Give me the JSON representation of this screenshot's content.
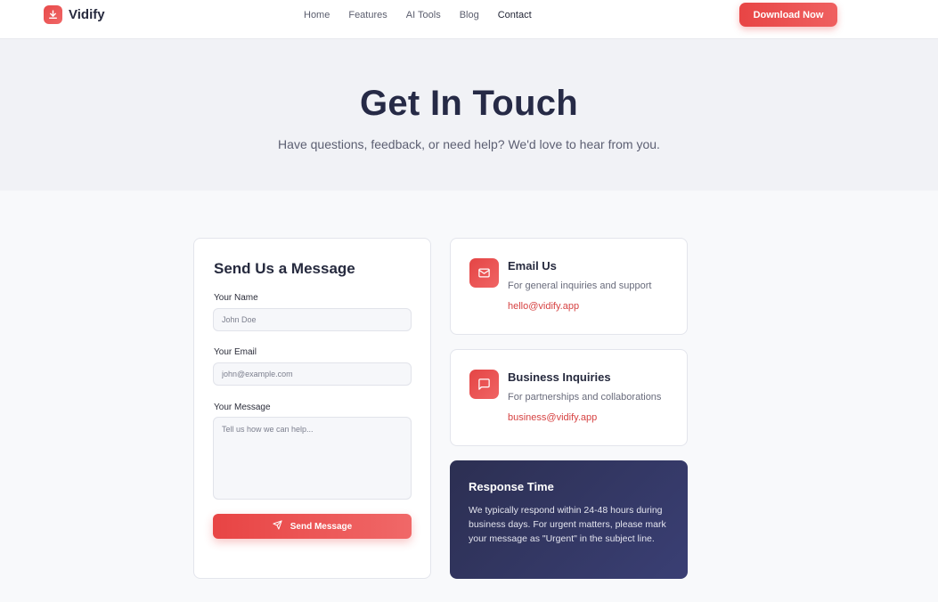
{
  "brand": {
    "name": "Vidify",
    "icon": "download-icon",
    "accent": "#e84545"
  },
  "nav": {
    "links": [
      {
        "label": "Home"
      },
      {
        "label": "Features"
      },
      {
        "label": "AI Tools"
      },
      {
        "label": "Blog"
      },
      {
        "label": "Contact",
        "active": true
      }
    ],
    "cta_label": "Download Now"
  },
  "hero": {
    "title": "Get In Touch",
    "subtitle": "Have questions, feedback, or need help? We'd love to hear from you."
  },
  "form": {
    "title": "Send Us a Message",
    "name_label": "Your Name",
    "name_placeholder": "John Doe",
    "email_label": "Your Email",
    "email_placeholder": "john@example.com",
    "message_label": "Your Message",
    "message_placeholder": "Tell us how we can help...",
    "submit_label": "Send Message",
    "submit_icon": "send-icon"
  },
  "contact_cards": [
    {
      "icon": "mail-icon",
      "title": "Email Us",
      "description": "For general inquiries and support",
      "link": "hello@vidify.app"
    },
    {
      "icon": "message-square-icon",
      "title": "Business Inquiries",
      "description": "For partnerships and collaborations",
      "link": "business@vidify.app"
    }
  ],
  "response": {
    "title": "Response Time",
    "text": "We typically respond within 24-48 hours during business days. For urgent matters, please mark your message as \"Urgent\" in the subject line."
  }
}
